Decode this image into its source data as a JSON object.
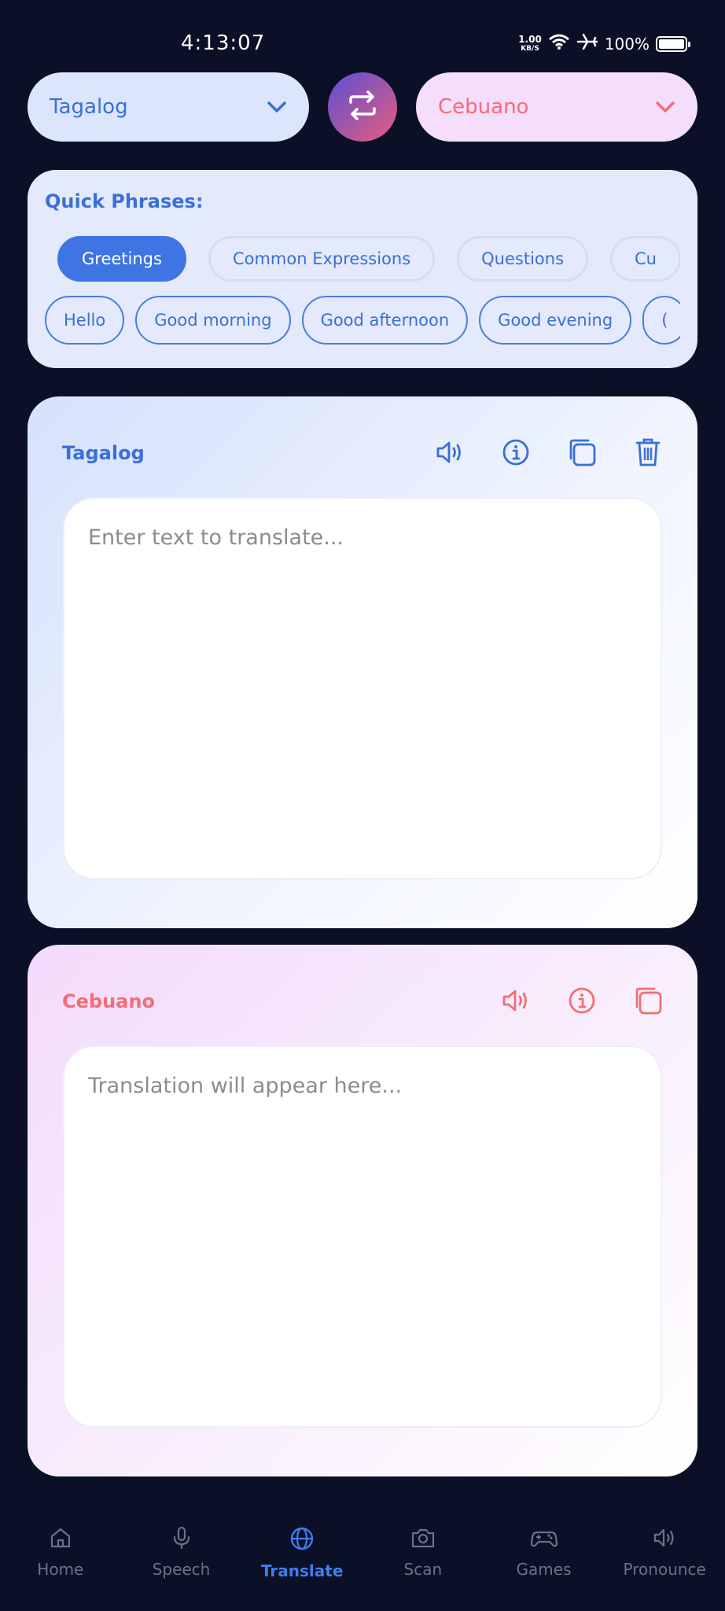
{
  "status_bar": {
    "time": "4:13:07",
    "net_speed_value": "1.00",
    "net_speed_unit": "KB/S",
    "battery": "100%"
  },
  "language_bar": {
    "source_language": "Tagalog",
    "target_language": "Cebuano"
  },
  "quick_phrases": {
    "title": "Quick Phrases:",
    "categories": [
      {
        "label": "Greetings",
        "active": true
      },
      {
        "label": "Common Expressions",
        "active": false
      },
      {
        "label": "Questions",
        "active": false
      },
      {
        "label": "Cu",
        "active": false
      }
    ],
    "phrases": [
      "Hello",
      "Good morning",
      "Good afternoon",
      "Good evening",
      "("
    ]
  },
  "source_panel": {
    "label": "Tagalog",
    "placeholder": "Enter text to translate...",
    "text": ""
  },
  "target_panel": {
    "label": "Cebuano",
    "placeholder": "Translation will appear here...",
    "text": ""
  },
  "bottom_nav": [
    {
      "label": "Home",
      "icon": "home-icon",
      "active": false
    },
    {
      "label": "Speech",
      "icon": "microphone-icon",
      "active": false
    },
    {
      "label": "Translate",
      "icon": "globe-icon",
      "active": true
    },
    {
      "label": "Scan",
      "icon": "camera-icon",
      "active": false
    },
    {
      "label": "Games",
      "icon": "gamepad-icon",
      "active": false
    },
    {
      "label": "Pronounce",
      "icon": "speaker-icon",
      "active": false
    }
  ],
  "colors": {
    "background": "#0b1026",
    "source_accent": "#3a6fd8",
    "target_accent": "#f26e74",
    "active_nav": "#3f7df0"
  }
}
